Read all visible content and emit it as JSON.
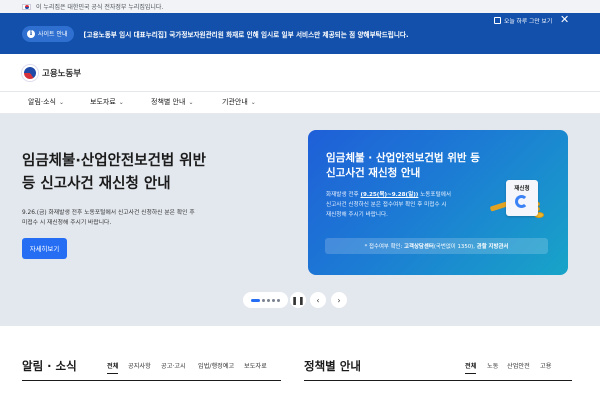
{
  "gov_strip": {
    "text": "이 누리집은 대한민국 공식 전자정부 누리집입니다."
  },
  "notice": {
    "badge_label": "사이트 안내",
    "message": "[고용노동부 임시 대표누리집] 국가정보자원관리원 화재로 인해 임시로 일부 서비스만 제공되는 점 양해부탁드립니다.",
    "checkbox_label": "오늘 하루 그만 보기",
    "close_icon": "close-icon"
  },
  "header": {
    "logo_text": "고용노동부"
  },
  "gnb": {
    "items": [
      {
        "label": "알림·소식"
      },
      {
        "label": "보도자료"
      },
      {
        "label": "정책별 안내"
      },
      {
        "label": "기관안내"
      }
    ]
  },
  "hero": {
    "title_line1": "임금체불·산업안전보건법 위반",
    "title_line2": "등 신고사건 재신청 안내",
    "desc_line1": "9.26.(금) 화재발생 전후 노동포털에서 신고사건 신청하신 분은 확인 후",
    "desc_line2": "미접수 시 재신청해 주시기 바랍니다.",
    "button_label": "자세히보기"
  },
  "card": {
    "title_line1": "임금체불 · 산업안전보건법 위반 등",
    "title_line2": "신고사건 재신청 안내",
    "desc_prefix": "화재발생 전후",
    "desc_dates": "(9.25(목)~9.28(일))",
    "desc_suffix": "노동포털에서",
    "desc_line2": "신고사건 신청하신 분은 접수여부 확인 후 미접수 시",
    "desc_line3": "재신청해 주시기 바랍니다.",
    "pill_prefix": "* 접수여부 확인:",
    "pill_center": "고객상담센터",
    "pill_mid": "(국번없이 1350),",
    "pill_office": "관할 지방관서",
    "doc_label": "재신청"
  },
  "carousel": {
    "total_slides": 5,
    "active_slide": 1,
    "pause_icon": "pause-icon",
    "prev_icon": "chevron-left-icon",
    "next_icon": "chevron-right-icon"
  },
  "news_section": {
    "title": "알림 · 소식",
    "tabs": [
      "전체",
      "공지사항",
      "공고·고시",
      "입법/행정예고",
      "보도자료"
    ]
  },
  "policy_section": {
    "title": "정책별 안내",
    "tabs": [
      "전체",
      "노동",
      "산업안전",
      "고용"
    ]
  }
}
